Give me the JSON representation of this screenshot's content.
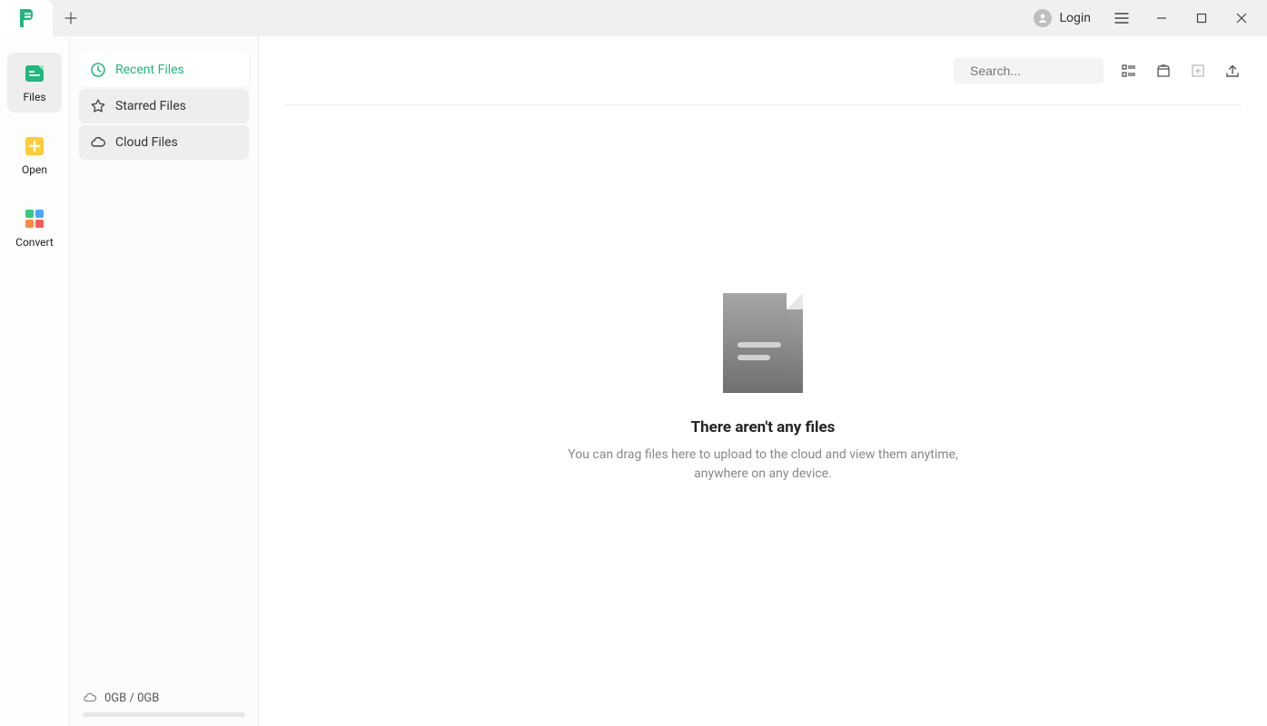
{
  "titlebar": {
    "login_label": "Login"
  },
  "leftnav": {
    "items": [
      {
        "label": "Files"
      },
      {
        "label": "Open"
      },
      {
        "label": "Convert"
      }
    ]
  },
  "sidebar": {
    "items": [
      {
        "label": "Recent Files"
      },
      {
        "label": "Starred Files"
      },
      {
        "label": "Cloud Files"
      }
    ],
    "storage": "0GB / 0GB"
  },
  "toolbar": {
    "search_placeholder": "Search..."
  },
  "empty": {
    "title": "There aren't any files",
    "subtitle": "You can drag files here to upload to the cloud and view them anytime, anywhere on any device."
  }
}
